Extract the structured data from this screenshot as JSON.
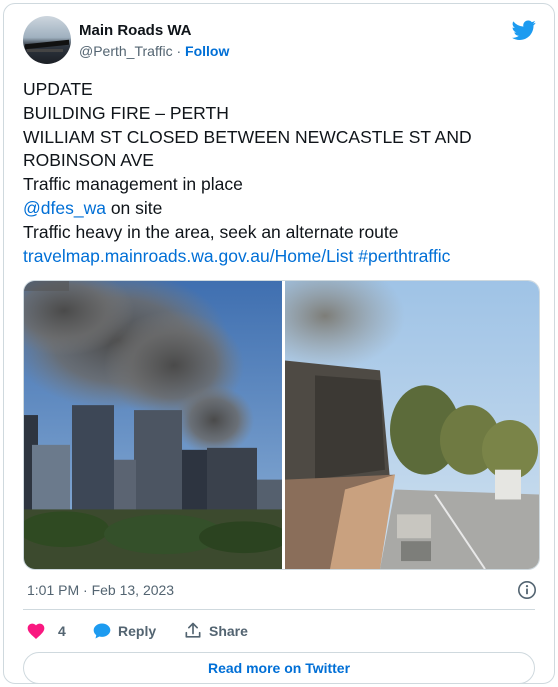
{
  "author": {
    "name": "Main Roads WA",
    "handle": "@Perth_Traffic",
    "separator": "·",
    "follow_label": "Follow",
    "avatar_icon": "bridge-photo-avatar",
    "platform_icon": "twitter-bird-icon"
  },
  "tweet": {
    "lines": [
      "UPDATE",
      "BUILDING FIRE – PERTH",
      "WILLIAM ST CLOSED BETWEEN NEWCASTLE ST AND",
      "ROBINSON AVE",
      "Traffic management in place"
    ],
    "mention": "@dfes_wa",
    "mention_suffix": " on site",
    "line_traffic": "Traffic heavy in the area, seek an alternate route",
    "url": "travelmap.mainroads.wa.gov.au/Home/List",
    "hashtag": "#perthtraffic"
  },
  "media": {
    "photos": [
      "city-skyline-smoke-photo",
      "street-smoke-photo"
    ]
  },
  "meta": {
    "timestamp": "1:01 PM · Feb 13, 2023"
  },
  "actions": {
    "like_count": "4",
    "reply_label": "Reply",
    "share_label": "Share",
    "read_more_label": "Read more on Twitter"
  },
  "colors": {
    "link": "#006fd6",
    "like": "#f91880",
    "reply": "#1d9bf0",
    "twitter_blue": "#1d9bf0",
    "border": "#cfd9de",
    "muted": "#536471"
  }
}
